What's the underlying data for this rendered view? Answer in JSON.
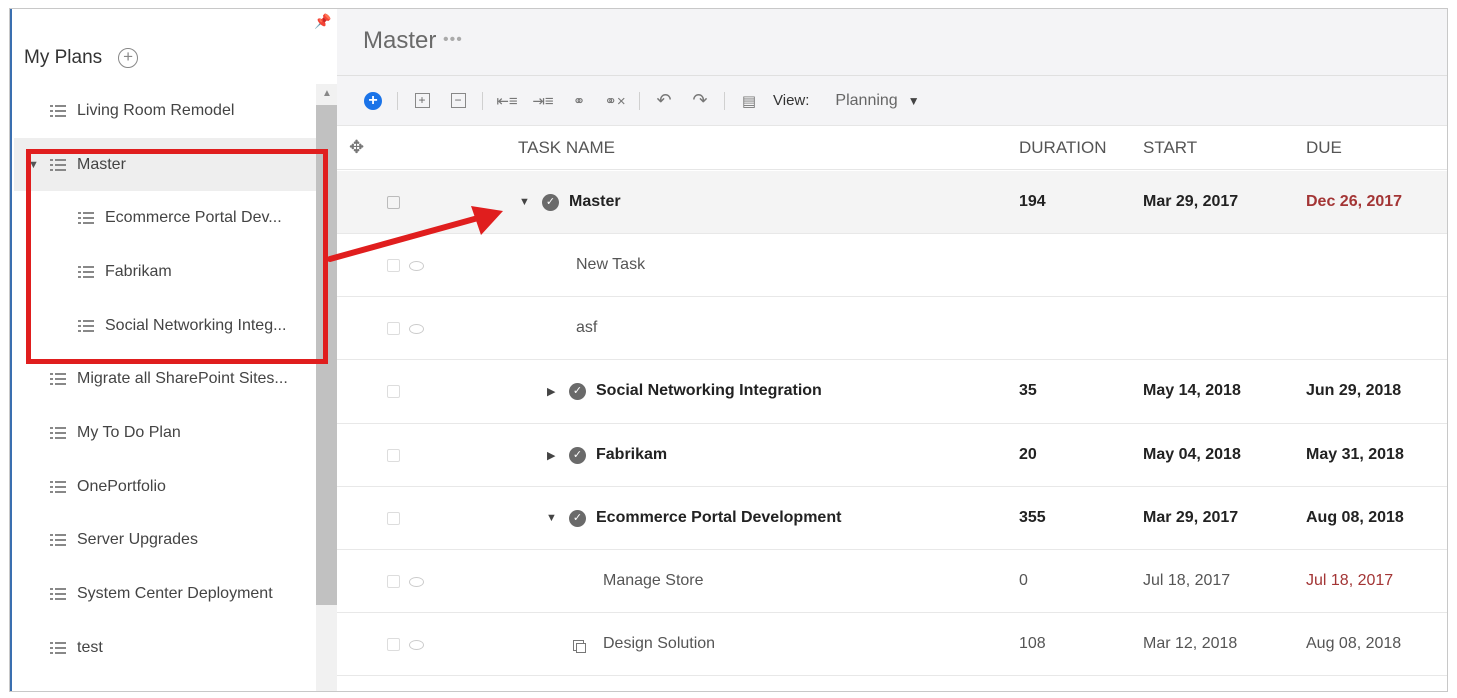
{
  "sidebar": {
    "title": "My Plans",
    "pin_icon": "pin-icon",
    "add_icon": "add-plan-icon",
    "items": [
      {
        "label": "Living Room Remodel",
        "level": 0
      },
      {
        "label": "Master",
        "level": 0,
        "expanded": true,
        "selected": true
      },
      {
        "label": "Ecommerce Portal Dev...",
        "level": 1
      },
      {
        "label": "Fabrikam",
        "level": 1
      },
      {
        "label": "Social Networking Integ...",
        "level": 1
      },
      {
        "label": "Migrate all SharePoint Sites...",
        "level": 0
      },
      {
        "label": "My To Do Plan",
        "level": 0
      },
      {
        "label": "OnePortfolio",
        "level": 0
      },
      {
        "label": "Server Upgrades",
        "level": 0
      },
      {
        "label": "System Center Deployment",
        "level": 0
      },
      {
        "label": "test",
        "level": 0
      }
    ]
  },
  "header": {
    "plan_title": "Master",
    "more": "•••"
  },
  "toolbar": {
    "view_label": "View:",
    "view_value": "Planning",
    "buttons": [
      "add-task",
      "expand-all",
      "collapse-all",
      "outdent",
      "indent",
      "link",
      "unlink",
      "undo",
      "redo",
      "details"
    ]
  },
  "columns": {
    "task_name": "TASK NAME",
    "duration": "DURATION",
    "start": "START",
    "due": "DUE"
  },
  "rows": [
    {
      "name": "Master",
      "duration": "194",
      "start": "Mar 29, 2017",
      "due": "Dec 26, 2017",
      "summary": true,
      "late": true
    },
    {
      "name": "New Task",
      "duration": "",
      "start": "",
      "due": ""
    },
    {
      "name": "asf",
      "duration": "",
      "start": "",
      "due": ""
    },
    {
      "name": "Social Networking Integration",
      "duration": "35",
      "start": "May 14, 2018",
      "due": "Jun 29, 2018",
      "summary": true
    },
    {
      "name": "Fabrikam",
      "duration": "20",
      "start": "May 04, 2018",
      "due": "May 31, 2018",
      "summary": true
    },
    {
      "name": "Ecommerce Portal Development",
      "duration": "355",
      "start": "Mar 29, 2017",
      "due": "Aug 08, 2018",
      "summary": true
    },
    {
      "name": "Manage Store",
      "duration": "0",
      "start": "Jul 18, 2017",
      "due": "Jul 18, 2017",
      "late": true
    },
    {
      "name": "Design Solution",
      "duration": "108",
      "start": "Mar 12, 2018",
      "due": "Aug 08, 2018"
    }
  ],
  "colors": {
    "accent": "#1a73e8",
    "late": "#a33535",
    "annotation": "#e01e1e"
  }
}
